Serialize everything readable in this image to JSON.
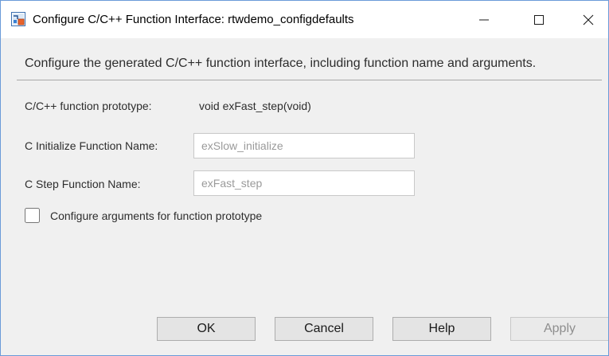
{
  "window": {
    "title": "Configure C/C++ Function Interface: rtwdemo_configdefaults",
    "icons": {
      "app": "simulink-model-icon",
      "minimize": "minimize-icon",
      "maximize": "maximize-icon",
      "close": "close-icon"
    }
  },
  "description": "Configure the generated C/C++ function interface, including function name and arguments.",
  "prototype": {
    "label": "C/C++ function prototype:",
    "value": "void exFast_step(void)"
  },
  "fields": {
    "init": {
      "label": "C Initialize Function Name:",
      "value": "exSlow_initialize"
    },
    "step": {
      "label": "C Step Function Name:",
      "value": "exFast_step"
    }
  },
  "checkbox": {
    "label": "Configure arguments for function prototype",
    "checked": false
  },
  "buttons": {
    "ok": "OK",
    "cancel": "Cancel",
    "help": "Help",
    "apply": "Apply"
  },
  "colors": {
    "window_border": "#6a9bd8",
    "dialog_background": "#f0f0f0",
    "disabled_text": "#8e8e8e"
  }
}
